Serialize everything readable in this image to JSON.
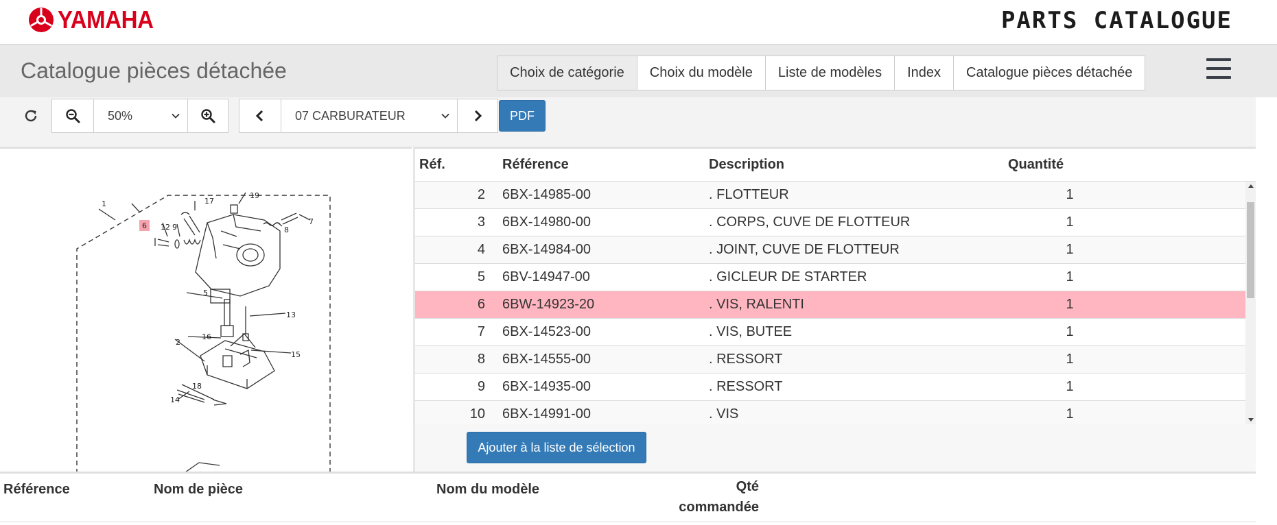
{
  "brand": {
    "name": "YAMAHA",
    "catalogue_logo_text": "PARTS CATALOGUE",
    "accent_color": "#d9001b"
  },
  "header": {
    "title": "Catalogue pièces détachée"
  },
  "nav": {
    "tabs": [
      {
        "label": "Choix de catégorie",
        "active": true
      },
      {
        "label": "Choix du modèle",
        "active": false
      },
      {
        "label": "Liste de modèles",
        "active": false
      },
      {
        "label": "Index",
        "active": false
      },
      {
        "label": "Catalogue pièces détachée",
        "active": false
      }
    ],
    "menu_icon": "hamburger-menu-icon"
  },
  "toolbar": {
    "zoom_value": "50%",
    "category_value": "07 CARBURATEUR",
    "pdf_label": "PDF",
    "icons": [
      "refresh-icon",
      "zoom-out-icon",
      "zoom-in-icon",
      "chevron-left-icon",
      "chevron-right-icon"
    ]
  },
  "diagram": {
    "highlight_color": "#ffb6c1",
    "callouts": [
      "1",
      "17",
      "19",
      "8",
      "7",
      "6",
      "12",
      "9",
      "5",
      "13",
      "16",
      "15",
      "2",
      "18",
      "14"
    ],
    "highlighted_callout": "6"
  },
  "parts_table": {
    "headers": {
      "ref": "Réf.",
      "reference": "Référence",
      "description": "Description",
      "quantity": "Quantité"
    },
    "rows": [
      {
        "ref": "2",
        "reference": "6BX-14985-00",
        "description": ". FLOTTEUR",
        "qty": "1",
        "highlighted": false
      },
      {
        "ref": "3",
        "reference": "6BX-14980-00",
        "description": ". CORPS, CUVE DE FLOTTEUR",
        "qty": "1",
        "highlighted": false
      },
      {
        "ref": "4",
        "reference": "6BX-14984-00",
        "description": ". JOINT, CUVE DE FLOTTEUR",
        "qty": "1",
        "highlighted": false
      },
      {
        "ref": "5",
        "reference": "6BV-14947-00",
        "description": ". GICLEUR DE STARTER",
        "qty": "1",
        "highlighted": false
      },
      {
        "ref": "6",
        "reference": "6BW-14923-20",
        "description": ". VIS, RALENTI",
        "qty": "1",
        "highlighted": true
      },
      {
        "ref": "7",
        "reference": "6BX-14523-00",
        "description": ". VIS, BUTEE",
        "qty": "1",
        "highlighted": false
      },
      {
        "ref": "8",
        "reference": "6BX-14555-00",
        "description": ". RESSORT",
        "qty": "1",
        "highlighted": false
      },
      {
        "ref": "9",
        "reference": "6BX-14935-00",
        "description": ". RESSORT",
        "qty": "1",
        "highlighted": false
      },
      {
        "ref": "10",
        "reference": "6BX-14991-00",
        "description": ". VIS",
        "qty": "1",
        "highlighted": false
      }
    ],
    "add_button_label": "Ajouter à la liste de sélection",
    "highlight_color": "#ffb6c1"
  },
  "selection_table": {
    "headers": {
      "reference": "Référence",
      "part_name": "Nom de pièce",
      "model_name": "Nom du modèle",
      "qty_line1": "Qté",
      "qty_line2": "commandée"
    }
  }
}
